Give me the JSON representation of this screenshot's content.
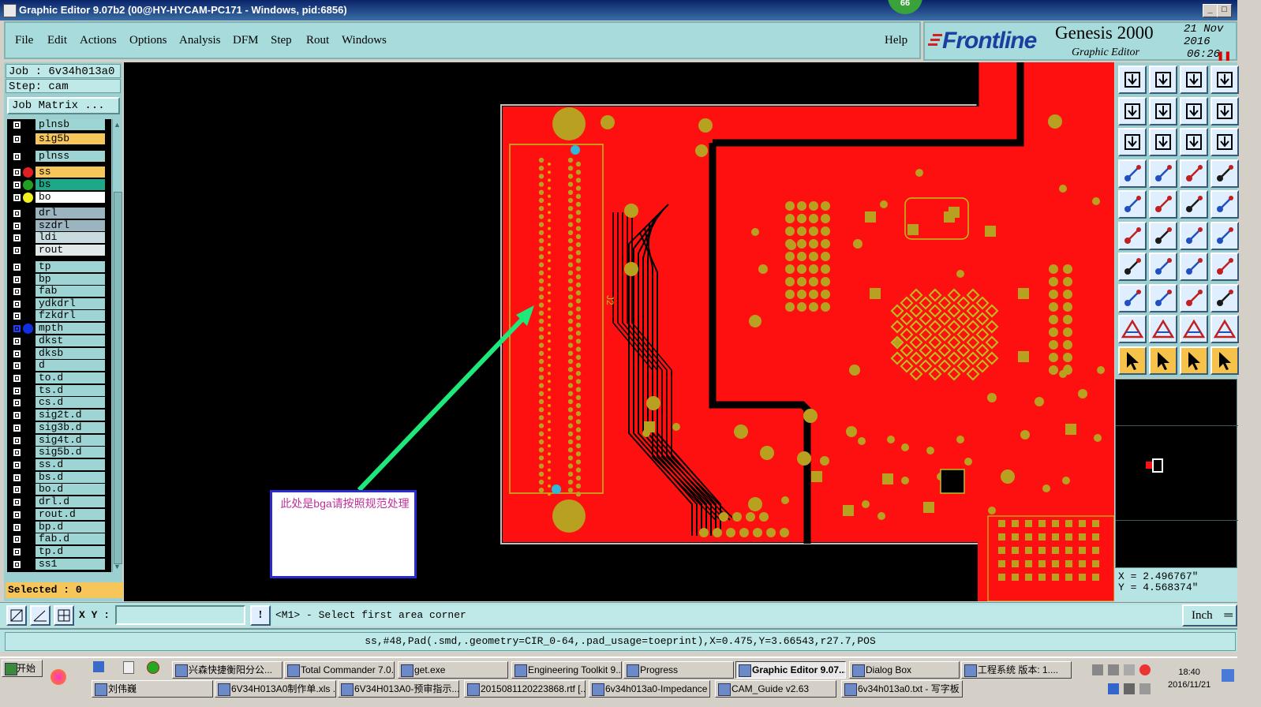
{
  "window": {
    "title": "Graphic Editor 9.07b2 (00@HY-HYCAM-PC171 - Windows, pid:6856)",
    "badge": "66"
  },
  "menu": {
    "items": [
      "File",
      "Edit",
      "Actions",
      "Options",
      "Analysis",
      "DFM",
      "Step",
      "Rout",
      "Windows"
    ],
    "help": "Help"
  },
  "brand": {
    "logo": "Frontline",
    "product": "Genesis 2000",
    "subtitle": "Graphic Editor",
    "date": "21 Nov 2016",
    "time": "06:26 PM"
  },
  "job": {
    "job_line": "Job : 6v34h013a0",
    "step_line": "Step: cam",
    "matrix_button": "Job Matrix ...",
    "selected": "Selected : 0"
  },
  "layers": [
    {
      "name": "plnsb",
      "color": "#9ed4d4",
      "dot": ""
    },
    {
      "name": "sig5b",
      "color": "#f6c65a",
      "dot": ""
    },
    {
      "name": "plnss",
      "color": "#9ed4d4",
      "dot": ""
    },
    {
      "name": "ss",
      "color": "#f6c65a",
      "dot": "#e02020"
    },
    {
      "name": "bs",
      "color": "#1ea88a",
      "dot": "#20a020"
    },
    {
      "name": "bo",
      "color": "#ffffff",
      "dot": "#f0f020"
    },
    {
      "name": "drl",
      "color": "#9ab4c0",
      "dot": ""
    },
    {
      "name": "szdrl",
      "color": "#9ab4c0",
      "dot": ""
    },
    {
      "name": "ldi",
      "color": "#c8dce0",
      "dot": ""
    },
    {
      "name": "rout",
      "color": "#e0e8e8",
      "dot": ""
    },
    {
      "name": "tp",
      "color": "#9ed4d4",
      "dot": ""
    },
    {
      "name": "bp",
      "color": "#9ed4d4",
      "dot": ""
    },
    {
      "name": "fab",
      "color": "#9ed4d4",
      "dot": ""
    },
    {
      "name": "ydkdrl",
      "color": "#9ed4d4",
      "dot": ""
    },
    {
      "name": "fzkdrl",
      "color": "#9ed4d4",
      "dot": ""
    },
    {
      "name": "mpth",
      "color": "#9ed4d4",
      "dot": "#1030e0"
    },
    {
      "name": "dkst",
      "color": "#9ed4d4",
      "dot": ""
    },
    {
      "name": "dksb",
      "color": "#9ed4d4",
      "dot": ""
    },
    {
      "name": "d",
      "color": "#9ed4d4",
      "dot": ""
    },
    {
      "name": "to.d",
      "color": "#9ed4d4",
      "dot": ""
    },
    {
      "name": "ts.d",
      "color": "#9ed4d4",
      "dot": ""
    },
    {
      "name": "cs.d",
      "color": "#9ed4d4",
      "dot": ""
    },
    {
      "name": "sig2t.d",
      "color": "#9ed4d4",
      "dot": ""
    },
    {
      "name": "sig3b.d",
      "color": "#9ed4d4",
      "dot": ""
    },
    {
      "name": "sig4t.d",
      "color": "#9ed4d4",
      "dot": ""
    },
    {
      "name": "sig5b.d",
      "color": "#9ed4d4",
      "dot": ""
    },
    {
      "name": "ss.d",
      "color": "#9ed4d4",
      "dot": ""
    },
    {
      "name": "bs.d",
      "color": "#9ed4d4",
      "dot": ""
    },
    {
      "name": "bo.d",
      "color": "#9ed4d4",
      "dot": ""
    },
    {
      "name": "drl.d",
      "color": "#9ed4d4",
      "dot": ""
    },
    {
      "name": "rout.d",
      "color": "#9ed4d4",
      "dot": ""
    },
    {
      "name": "bp.d",
      "color": "#9ed4d4",
      "dot": ""
    },
    {
      "name": "fab.d",
      "color": "#9ed4d4",
      "dot": ""
    },
    {
      "name": "tp.d",
      "color": "#9ed4d4",
      "dot": ""
    },
    {
      "name": "ss1",
      "color": "#9ed4d4",
      "dot": ""
    }
  ],
  "note": {
    "text": "此处是bga请按照规范处理"
  },
  "coords": {
    "x": "X = 2.496767\"",
    "y": "Y = 4.568374\""
  },
  "command": {
    "xy_label": "X Y :",
    "xy_value": "",
    "prompt": "<M1> - Select first area corner",
    "units": "Inch"
  },
  "status": "ss,#48,Pad(.smd,.geometry=CIR_0-64,.pad_usage=toeprint),X=0.475,Y=3.66543,r27.7,POS",
  "taskbar": {
    "start": "开始",
    "row1": [
      "兴森快捷衡阳分公...",
      "Total Commander 7.0...",
      "get.exe",
      "Engineering Toolkit 9....",
      "Progress",
      "Graphic Editor 9.07...",
      "Dialog Box",
      "工程系统  版本: 1...."
    ],
    "row2": [
      "刘伟巍",
      "6V34H013A0制作单.xls ...",
      "6V34H013A0-预审指示...",
      "20150811202238​68.rtf [...",
      "6v34h013a0-Impedance ...",
      "CAM_Guide v2.63",
      "6v34h013a0.txt - 写字板"
    ],
    "time": "18:40",
    "date": "2016/11/21"
  },
  "colors": {
    "board": "#ff1010",
    "pad": "#b8a020",
    "accent": "#1ee87a",
    "panel": "#9cd0d0"
  }
}
